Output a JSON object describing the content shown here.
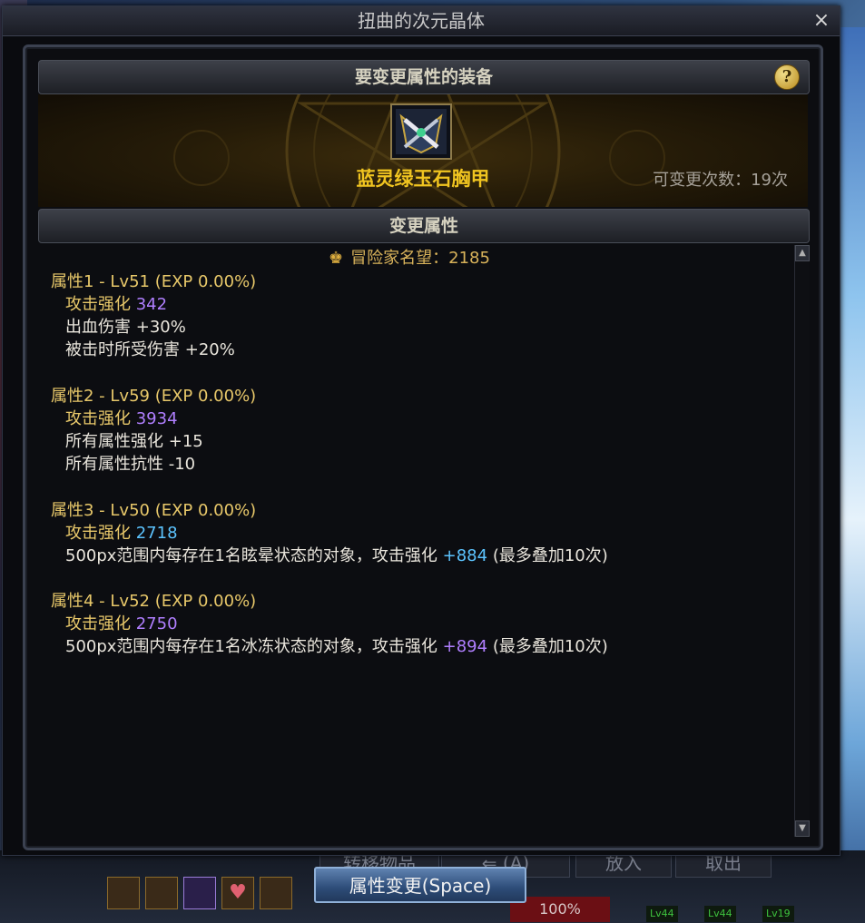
{
  "window": {
    "title": "扭曲的次元晶体",
    "close_glyph": "×"
  },
  "equipment_section": {
    "header": "要变更属性的装备",
    "help_glyph": "?",
    "item_name": "蓝灵绿玉石胸甲",
    "change_count": "可变更次数：19次"
  },
  "attribute_section": {
    "header": "变更属性",
    "fame": "冒险家名望：2185",
    "groups": [
      {
        "head": "属性1 - Lv51 (EXP 0.00%)",
        "lines": [
          {
            "label": "攻击强化",
            "value": "342",
            "value_color": "purple"
          },
          {
            "label": "出血伤害",
            "value": "+30%"
          },
          {
            "label": "被击时所受伤害",
            "value": "+20%"
          }
        ]
      },
      {
        "head": "属性2 - Lv59 (EXP 0.00%)",
        "lines": [
          {
            "label": "攻击强化",
            "value": "3934",
            "value_color": "purple"
          },
          {
            "label": "所有属性强化",
            "value": "+15"
          },
          {
            "label": "所有属性抗性",
            "value": "-10"
          }
        ]
      },
      {
        "head": "属性3 - Lv50 (EXP 0.00%)",
        "lines": [
          {
            "label": "攻击强化",
            "value": "2718",
            "value_color": "cyan"
          },
          {
            "label": "500px范围内每存在1名眩晕状态的对象，攻击强化",
            "value": "+884",
            "value_color": "cyan",
            "suffix": "(最多叠加10次)"
          }
        ]
      },
      {
        "head": "属性4 - Lv52 (EXP 0.00%)",
        "lines": [
          {
            "label": "攻击强化",
            "value": "2750",
            "value_color": "purple"
          },
          {
            "label": "500px范围内每存在1名冰冻状态的对象，攻击强化",
            "value": "+894",
            "value_color": "purple",
            "suffix": "(最多叠加10次)"
          }
        ]
      }
    ]
  },
  "apply_button": "属性变更(Space)",
  "hud": {
    "transfer_label": "转移物品",
    "key_hint": "(A)",
    "put_in": "放入",
    "take_out": "取出",
    "percent": "100%",
    "lv_tags": [
      "Lv44",
      "Lv44",
      "Lv19"
    ]
  },
  "colors": {
    "gold": "#e8c86a",
    "purple": "#b07fff",
    "cyan": "#5cc4ff",
    "item_name": "#f0c420"
  }
}
